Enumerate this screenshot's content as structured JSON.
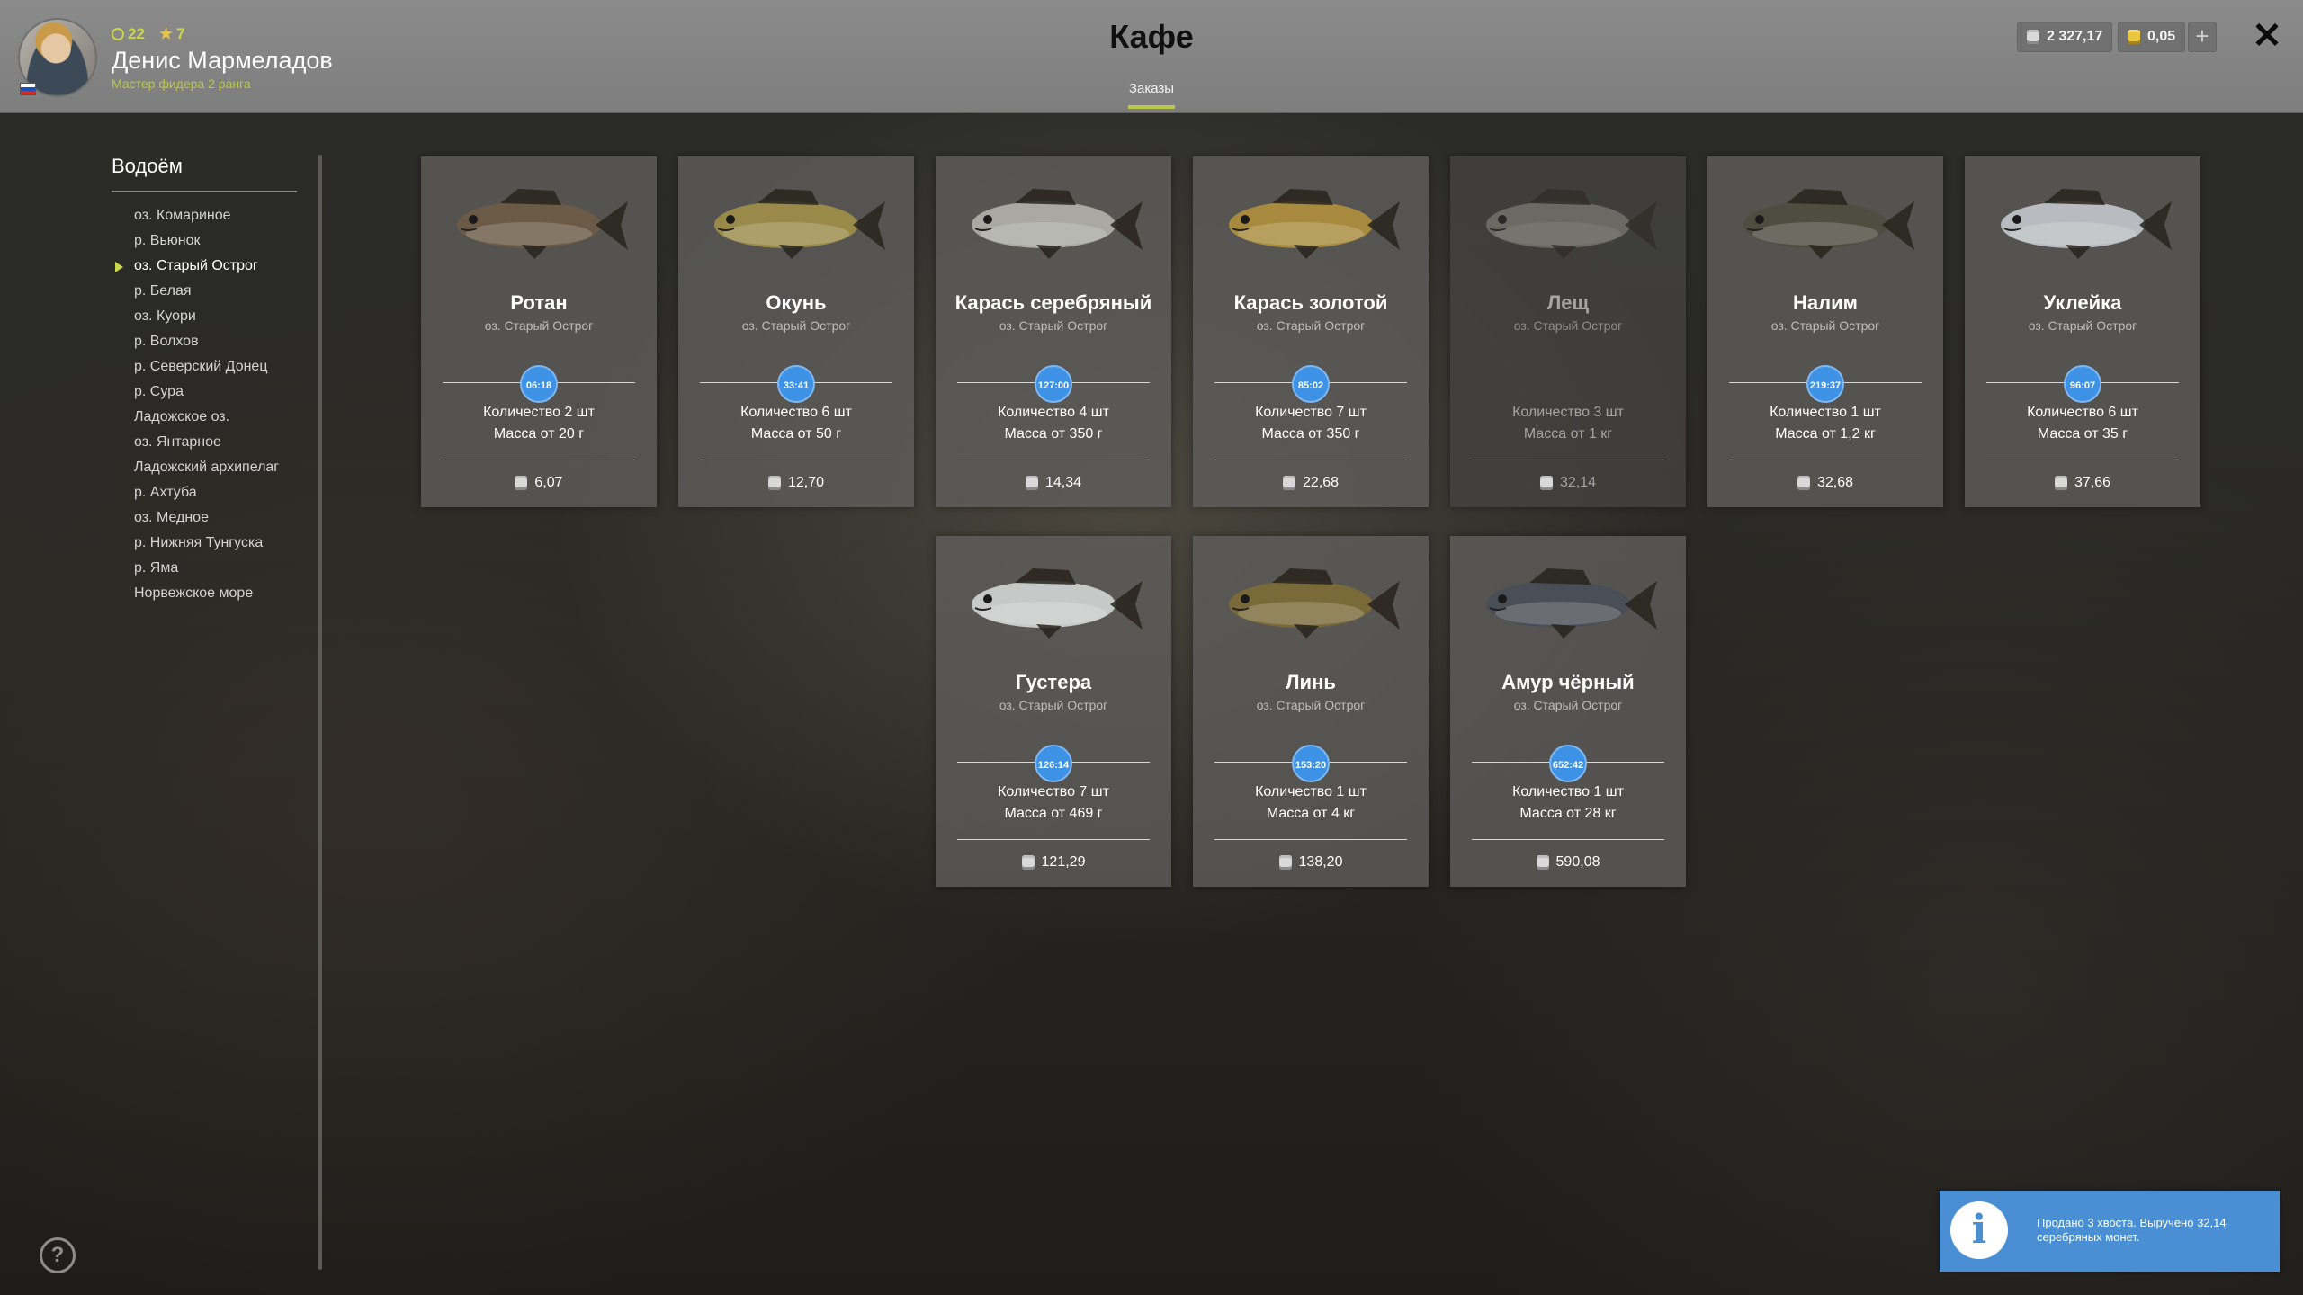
{
  "header": {
    "title": "Кафе",
    "tab_label": "Заказы",
    "player": {
      "name": "Денис Мармеладов",
      "rank": "Мастер фидера 2 ранга",
      "level": "22",
      "stars": "7"
    },
    "currency": {
      "silver": "2 327,17",
      "gold": "0,05"
    },
    "plus_label": "+",
    "close_label": "✕"
  },
  "sidebar": {
    "title": "Водоём",
    "items": [
      {
        "label": "оз. Комариное"
      },
      {
        "label": "р. Вьюнок"
      },
      {
        "label": "оз. Старый Острог",
        "active": true
      },
      {
        "label": "р. Белая"
      },
      {
        "label": "оз. Куори"
      },
      {
        "label": "р. Волхов"
      },
      {
        "label": "р. Северский Донец"
      },
      {
        "label": "р. Сура"
      },
      {
        "label": "Ладожское оз."
      },
      {
        "label": "оз. Янтарное"
      },
      {
        "label": "Ладожский архипелаг"
      },
      {
        "label": "р. Ахтуба"
      },
      {
        "label": "оз. Медное"
      },
      {
        "label": "р. Нижняя Тунгуска"
      },
      {
        "label": "р. Яма"
      },
      {
        "label": "Норвежское море"
      }
    ]
  },
  "orders": [
    {
      "name": "Ротан",
      "location": "оз. Старый Острог",
      "timer": "06:18",
      "quantity": "Количество 2 шт",
      "mass": "Масса от 20 г",
      "price": "6,07",
      "icon": "rotan-fish-icon",
      "color": "#6b5a45"
    },
    {
      "name": "Окунь",
      "location": "оз. Старый Острог",
      "timer": "33:41",
      "quantity": "Количество 6 шт",
      "mass": "Масса от 50 г",
      "price": "12,70",
      "icon": "perch-fish-icon",
      "color": "#9a8a4a"
    },
    {
      "name": "Карась серебряный",
      "location": "оз. Старый Острог",
      "timer": "127:00",
      "quantity": "Количество 4 шт",
      "mass": "Масса от 350 г",
      "price": "14,34",
      "icon": "silver-carp-fish-icon",
      "color": "#a9a9a2"
    },
    {
      "name": "Карась золотой",
      "location": "оз. Старый Острог",
      "timer": "85:02",
      "quantity": "Количество 7 шт",
      "mass": "Масса от 350 г",
      "price": "22,68",
      "icon": "golden-carp-fish-icon",
      "color": "#a88a3e"
    },
    {
      "name": "Лещ",
      "location": "оз. Старый Острог",
      "timer": "",
      "quantity": "Количество 3 шт",
      "mass": "Масса от 1 кг",
      "price": "32,14",
      "icon": "bream-fish-icon",
      "color": "#8f8d84",
      "dim": true
    },
    {
      "name": "Налим",
      "location": "оз. Старый Острог",
      "timer": "219:37",
      "quantity": "Количество 1 шт",
      "mass": "Масса от 1,2 кг",
      "price": "32,68",
      "icon": "burbot-fish-icon",
      "color": "#4f4c40"
    },
    {
      "name": "Уклейка",
      "location": "оз. Старый Острог",
      "timer": "96:07",
      "quantity": "Количество 6 шт",
      "mass": "Масса от 35 г",
      "price": "37,66",
      "icon": "bleak-fish-icon",
      "color": "#b8bcc0"
    },
    {
      "name": "Густера",
      "location": "оз. Старый Острог",
      "timer": "126:14",
      "quantity": "Количество 7 шт",
      "mass": "Масса от 469 г",
      "price": "121,29",
      "icon": "silver-bream-fish-icon",
      "color": "#c7c9c8"
    },
    {
      "name": "Линь",
      "location": "оз. Старый Острог",
      "timer": "153:20",
      "quantity": "Количество 1 шт",
      "mass": "Масса от 4 кг",
      "price": "138,20",
      "icon": "tench-fish-icon",
      "color": "#7a6a3a"
    },
    {
      "name": "Амур чёрный",
      "location": "оз. Старый Острог",
      "timer": "652:42",
      "quantity": "Количество 1 шт",
      "mass": "Масса от 28 кг",
      "price": "590,08",
      "icon": "black-carp-fish-icon",
      "color": "#4a4e56"
    }
  ],
  "notification": {
    "text": "Продано 3 хвоста. Выручено 32,14 серебряных монет.",
    "icon": "info-icon"
  },
  "help_label": "?",
  "colors": {
    "accent": "#c8d84a",
    "timer": "#3e92e6",
    "notification": "#4a8fd3"
  }
}
